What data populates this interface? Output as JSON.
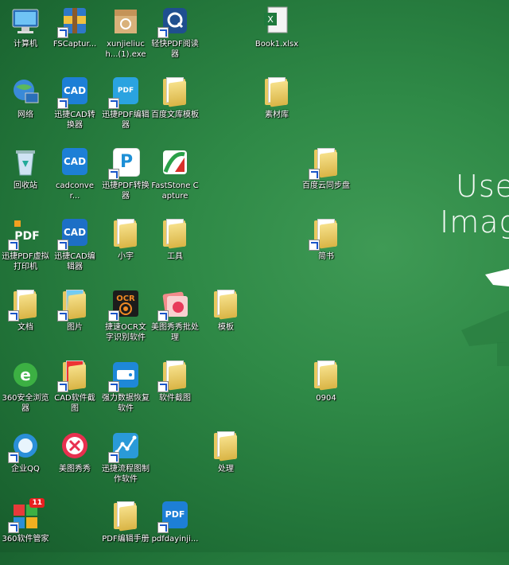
{
  "wallpaper": {
    "line1": "Use",
    "line2": "Imag"
  },
  "colors": {
    "desktop_green": "#2f8a47",
    "folder_yellow": "#e8c860",
    "cad_blue": "#1d7fd6"
  },
  "icons": [
    {
      "label": "计算机",
      "icon": "computer-icon"
    },
    {
      "label": "FSCaptur...",
      "icon": "archive-icon"
    },
    {
      "label": "xunjieliuch...(1).exe",
      "icon": "installer-package-icon"
    },
    {
      "label": "轻快PDF阅读器",
      "icon": "pdf-reader-icon"
    },
    {
      "label": "Book1.xlsx",
      "icon": "excel-file-icon"
    },
    {
      "label": "网络",
      "icon": "network-icon"
    },
    {
      "label": "迅捷CAD转换器",
      "icon": "cad-converter-icon"
    },
    {
      "label": "迅捷PDF编辑器",
      "icon": "pdf-editor-icon"
    },
    {
      "label": "百度文库模板",
      "icon": "folder-icon"
    },
    {
      "label": "素材库",
      "icon": "folder-icon"
    },
    {
      "label": "回收站",
      "icon": "recycle-bin-icon"
    },
    {
      "label": "cadconver...",
      "icon": "cad-converter-icon"
    },
    {
      "label": "迅捷PDF转换器",
      "icon": "pdf-converter-icon"
    },
    {
      "label": "FastStone Capture",
      "icon": "faststone-capture-icon"
    },
    {
      "label": "百度云同步盘",
      "icon": "folder-icon"
    },
    {
      "label": "迅捷PDF虚拟打印机",
      "icon": "pdf-printer-icon"
    },
    {
      "label": "迅捷CAD编辑器",
      "icon": "cad-editor-icon"
    },
    {
      "label": "小宇",
      "icon": "folder-icon"
    },
    {
      "label": "工具",
      "icon": "folder-icon"
    },
    {
      "label": "简书",
      "icon": "folder-icon"
    },
    {
      "label": "文档",
      "icon": "folder-icon"
    },
    {
      "label": "图片",
      "icon": "folder-icon"
    },
    {
      "label": "捷速OCR文字识别软件",
      "icon": "ocr-icon"
    },
    {
      "label": "美图秀秀批处理",
      "icon": "meitu-batch-icon"
    },
    {
      "label": "模板",
      "icon": "folder-icon"
    },
    {
      "label": "360安全浏览器",
      "icon": "browser-360-icon"
    },
    {
      "label": "CAD软件截图",
      "icon": "folder-icon"
    },
    {
      "label": "强力数据恢复软件",
      "icon": "data-recovery-icon"
    },
    {
      "label": "软件截图",
      "icon": "folder-icon"
    },
    {
      "label": "0904",
      "icon": "folder-icon"
    },
    {
      "label": "企业QQ",
      "icon": "enterprise-qq-icon"
    },
    {
      "label": "美图秀秀",
      "icon": "meitu-icon"
    },
    {
      "label": "迅捷流程图制作软件",
      "icon": "flowchart-icon"
    },
    {
      "label": "处理",
      "icon": "folder-icon"
    },
    {
      "label": "360软件管家",
      "icon": "software-manager-360-icon"
    },
    {
      "label": "11",
      "icon": "badge-count"
    },
    {
      "label": "PDF编辑手册",
      "icon": "folder-icon"
    },
    {
      "label": "pdfdayinji...",
      "icon": "pdf-printer-icon"
    }
  ]
}
